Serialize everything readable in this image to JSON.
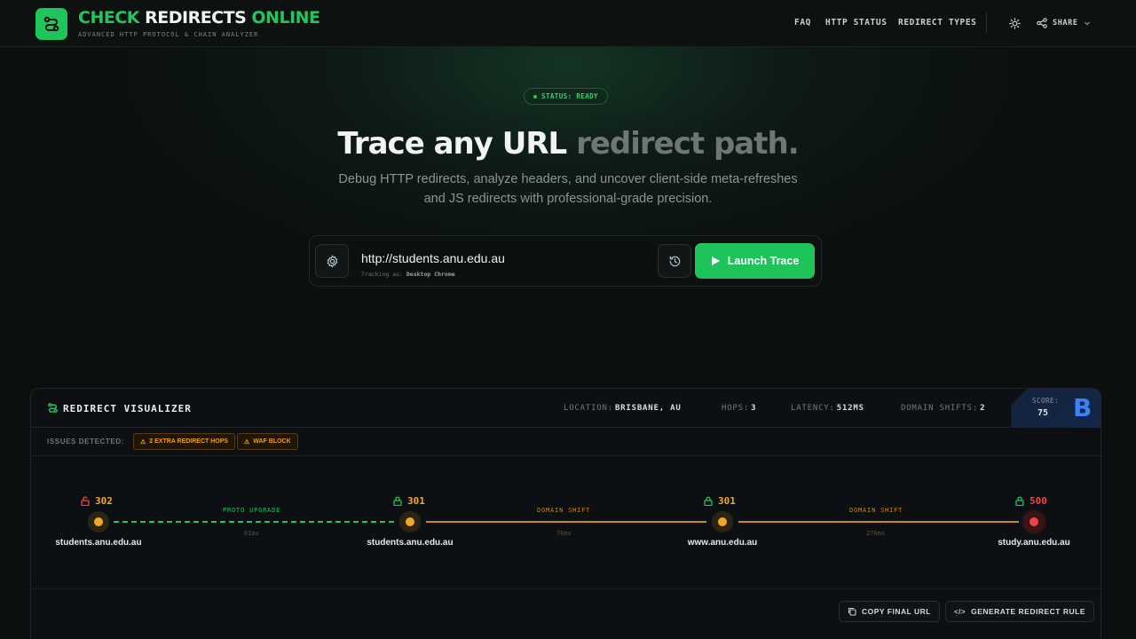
{
  "header": {
    "brand_part1": "CHECK",
    "brand_part2": "REDIRECTS",
    "brand_part3": "ONLINE",
    "tagline": "ADVANCED HTTP PROTOCOL & CHAIN ANALYZER",
    "nav": [
      "FAQ",
      "HTTP STATUS",
      "REDIRECT TYPES"
    ],
    "share_label": "SHARE"
  },
  "hero": {
    "status": "STATUS: READY",
    "title_main": "Trace any URL",
    "title_accent": "redirect path.",
    "subtitle": "Debug HTTP redirects, analyze headers, and uncover client-side meta-refreshes and JS redirects with professional-grade precision."
  },
  "search": {
    "url": "http://students.anu.edu.au",
    "hint_prefix": "Tracking as:",
    "hint_agent": "Desktop Chrome",
    "launch_label": "Launch Trace"
  },
  "visualizer": {
    "title": "REDIRECT VISUALIZER",
    "stats": {
      "location_label": "LOCATION:",
      "location": "BRISBANE, AU",
      "hops_label": "HOPS:",
      "hops": "3",
      "latency_label": "LATENCY:",
      "latency": "512MS",
      "shifts_label": "DOMAIN SHIFTS:",
      "shifts": "2"
    },
    "score_label": "SCORE:",
    "score": "75",
    "grade": "B",
    "issues_label": "ISSUES DETECTED:",
    "issues": [
      "2 EXTRA REDIRECT HOPS",
      "WAF BLOCK"
    ],
    "nodes": [
      {
        "code": "302",
        "host": "students.anu.edu.au",
        "secure": false
      },
      {
        "code": "301",
        "host": "students.anu.edu.au",
        "secure": true
      },
      {
        "code": "301",
        "host": "www.anu.edu.au",
        "secure": true
      },
      {
        "code": "500",
        "host": "study.anu.edu.au",
        "secure": true
      }
    ],
    "edges": [
      {
        "label": "PROTO UPGRADE",
        "ms": "81ms"
      },
      {
        "label": "DOMAIN SHIFT",
        "ms": "76ms"
      },
      {
        "label": "DOMAIN SHIFT",
        "ms": "276ms"
      }
    ],
    "actions": {
      "copy": "COPY FINAL URL",
      "generate": "GENERATE REDIRECT RULE"
    }
  },
  "colors": {
    "accent": "#22c55e",
    "warning": "#f59e0b",
    "error": "#ef4444",
    "grade": "#3b82f6"
  }
}
